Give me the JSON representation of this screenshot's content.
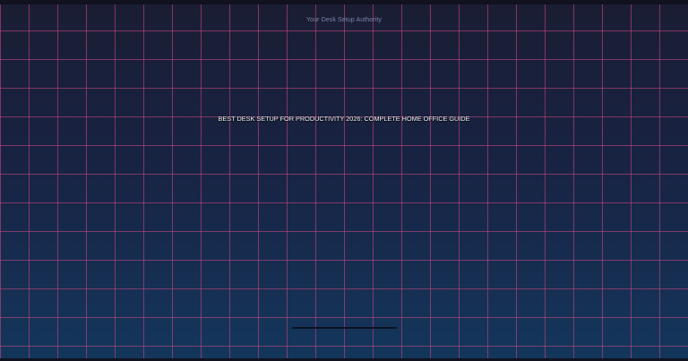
{
  "site": {
    "tagline": "Your Desk Setup Authority"
  },
  "hero": {
    "headline": "BEST DESK SETUP FOR PRODUCTIVITY 2026: COMPLETE HOME OFFICE GUIDE"
  },
  "loading": {
    "progress": 0
  },
  "colors": {
    "background_top": "#1a1d33",
    "background_bottom": "#14365c",
    "grid_line": "#d64884",
    "headline_text": "#f3f4f8",
    "tagline_text": "#7a86a8"
  }
}
